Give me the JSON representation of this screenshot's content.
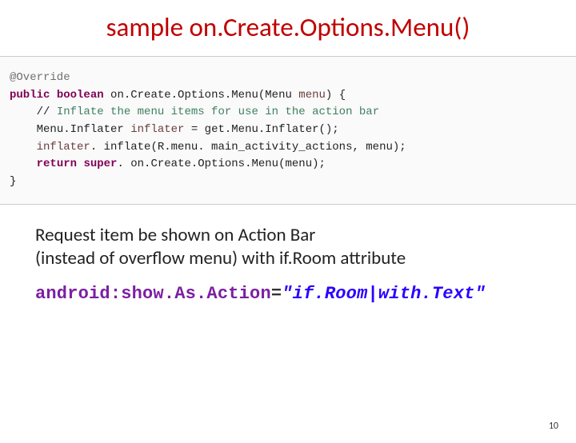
{
  "title": "sample on.Create.Options.Menu()",
  "code": {
    "annotation": "@Override",
    "kw_public": "public",
    "kw_boolean": "boolean",
    "method_name": " on.Create.Options.Menu",
    "param_type": "Menu ",
    "param_name": "menu",
    "brace_open": "{",
    "comment_slashes": "// ",
    "comment_text": "Inflate the menu items for use in the action bar",
    "l3_type": "Menu.Inflater ",
    "l3_var": "inflater",
    "l3_eq": " = ",
    "l3_call": "get.Menu.Inflater();",
    "l4_var": "inflater",
    "l4_rest": ". inflate(R.menu. main_activity_actions, menu);",
    "kw_return": "return",
    "kw_super": "super",
    "l5_rest": ". on.Create.Options.Menu(menu);",
    "brace_close": "}"
  },
  "caption_line1": "Request item be shown on Action Bar",
  "caption_line2": "(instead of overflow menu) with if.Room attribute",
  "xml": {
    "attr": "android:show.As.Action",
    "eq": "=",
    "val": "\"if.Room|with.Text\""
  },
  "page_number": "10"
}
